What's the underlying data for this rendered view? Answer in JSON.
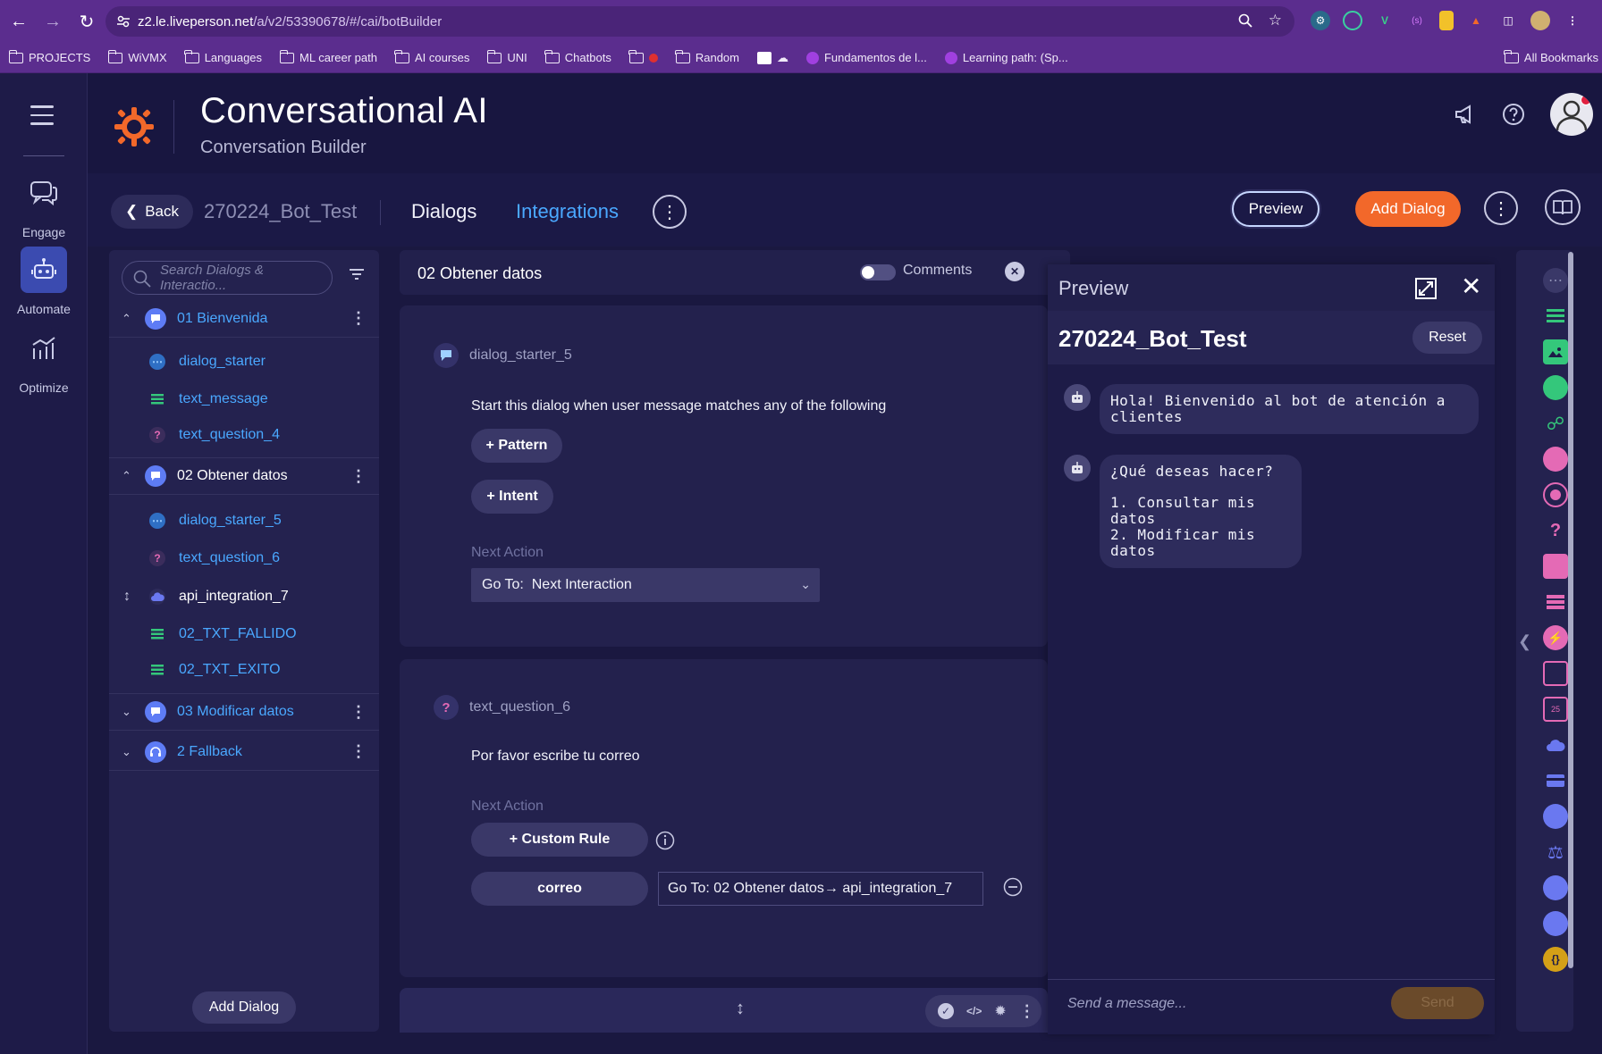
{
  "browser": {
    "url_host": "z2.le.liveperson.net",
    "url_path": "/a/v2/53390678/#/cai/botBuilder",
    "bookmarks": [
      "PROJECTS",
      "WiVMX",
      "Languages",
      "ML career path",
      "AI courses",
      "UNI",
      "Chatbots",
      "",
      "Random",
      "",
      "Fundamentos de l...",
      "Learning path: (Sp..."
    ],
    "all_bookmarks": "All Bookmarks"
  },
  "rail": {
    "items": [
      {
        "label": "Engage",
        "icon": "chat-bubbles-icon"
      },
      {
        "label": "Automate",
        "icon": "robot-icon"
      },
      {
        "label": "Optimize",
        "icon": "chart-icon"
      }
    ]
  },
  "header": {
    "title": "Conversational AI",
    "subtitle": "Conversation Builder"
  },
  "subbar": {
    "back_label": "Back",
    "bot_name": "270224_Bot_Test",
    "tab_dialogs": "Dialogs",
    "tab_integrations": "Integrations",
    "preview_label": "Preview",
    "add_dialog_label": "Add Dialog"
  },
  "tree": {
    "search_placeholder": "Search Dialogs & Interactio...",
    "groups": [
      {
        "label": "01 Bienvenida",
        "items": [
          {
            "label": "dialog_starter",
            "type": "chat"
          },
          {
            "label": "text_message",
            "type": "text"
          },
          {
            "label": "text_question_4",
            "type": "question"
          }
        ]
      },
      {
        "label": "02 Obtener datos",
        "items": [
          {
            "label": "dialog_starter_5",
            "type": "chat"
          },
          {
            "label": "text_question_6",
            "type": "question"
          },
          {
            "label": "api_integration_7",
            "type": "cloud"
          },
          {
            "label": "02_TXT_FALLIDO",
            "type": "text"
          },
          {
            "label": "02_TXT_EXITO",
            "type": "text"
          }
        ]
      },
      {
        "label": "03 Modificar datos",
        "items": []
      },
      {
        "label": "2 Fallback",
        "items": []
      }
    ],
    "add_dialog_label": "Add Dialog"
  },
  "canvas": {
    "title": "02 Obtener datos",
    "comments_label": "Comments",
    "card1": {
      "name": "dialog_starter_5",
      "text": "Start this dialog when user message matches any of the following",
      "pattern_label": "+ Pattern",
      "intent_label": "+ Intent",
      "next_action_label": "Next Action",
      "goto_prefix": "Go To:",
      "goto_value": "Next Interaction"
    },
    "card2": {
      "name": "text_question_6",
      "text": "Por favor escribe tu correo",
      "next_action_label": "Next Action",
      "custom_rule_label": "+ Custom Rule",
      "rule_name": "correo",
      "rule_target": "Go To: 02 Obtener datos→  api_integration_7"
    }
  },
  "preview": {
    "title": "Preview",
    "bot_name": "270224_Bot_Test",
    "reset_label": "Reset",
    "messages": [
      {
        "text": "Hola! Bienvenido al bot de atención a clientes"
      },
      {
        "line1": "¿Qué deseas hacer?",
        "line2": "1. Consultar mis datos",
        "line3": "2. Modificar mis datos"
      }
    ],
    "input_placeholder": "Send a message...",
    "send_label": "Send"
  },
  "colors": {
    "accent_orange": "#f2682a",
    "link_blue": "#4aa8ff",
    "browser_purple": "#5b2d8e",
    "app_bg": "#1a1840"
  }
}
